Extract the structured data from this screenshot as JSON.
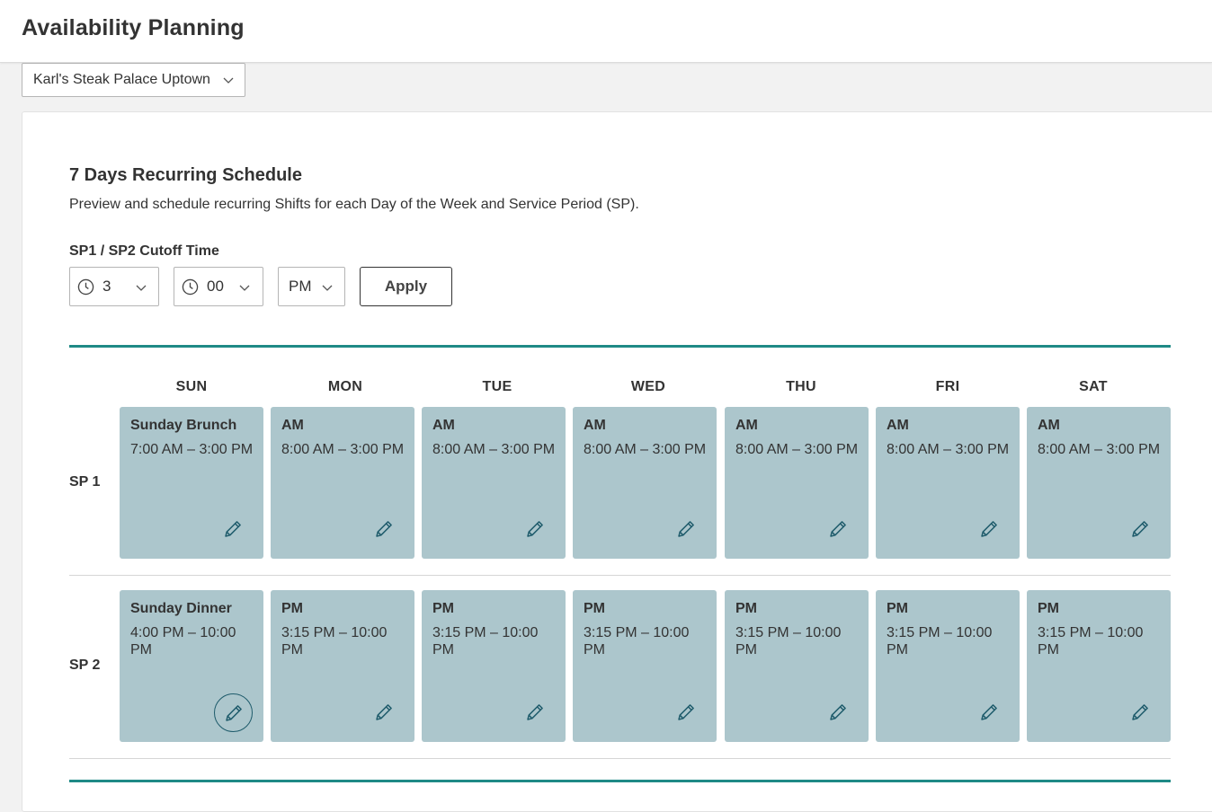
{
  "header": {
    "title": "Availability Planning"
  },
  "location": {
    "selected": "Karl's Steak Palace Uptown"
  },
  "schedule": {
    "title": "7 Days Recurring Schedule",
    "description": "Preview and schedule recurring Shifts for each Day of the Week and Service Period (SP).",
    "cutoff": {
      "label": "SP1 / SP2 Cutoff Time",
      "hour": "3",
      "minute": "00",
      "ampm": "PM",
      "apply_label": "Apply"
    },
    "days": [
      "SUN",
      "MON",
      "TUE",
      "WED",
      "THU",
      "FRI",
      "SAT"
    ],
    "rows": [
      {
        "label": "SP 1",
        "shifts": [
          {
            "name": "Sunday Brunch",
            "time": "7:00 AM – 3:00 PM"
          },
          {
            "name": "AM",
            "time": "8:00 AM – 3:00 PM"
          },
          {
            "name": "AM",
            "time": "8:00 AM – 3:00 PM"
          },
          {
            "name": "AM",
            "time": "8:00 AM – 3:00 PM"
          },
          {
            "name": "AM",
            "time": "8:00 AM – 3:00 PM"
          },
          {
            "name": "AM",
            "time": "8:00 AM – 3:00 PM"
          },
          {
            "name": "AM",
            "time": "8:00 AM – 3:00 PM"
          }
        ]
      },
      {
        "label": "SP 2",
        "shifts": [
          {
            "name": "Sunday Dinner",
            "time": "4:00 PM – 10:00 PM"
          },
          {
            "name": "PM",
            "time": "3:15 PM – 10:00 PM"
          },
          {
            "name": "PM",
            "time": "3:15 PM – 10:00 PM"
          },
          {
            "name": "PM",
            "time": "3:15 PM – 10:00 PM"
          },
          {
            "name": "PM",
            "time": "3:15 PM – 10:00 PM"
          },
          {
            "name": "PM",
            "time": "3:15 PM – 10:00 PM"
          },
          {
            "name": "PM",
            "time": "3:15 PM – 10:00 PM"
          }
        ]
      }
    ]
  },
  "icons": {
    "edit": "pencil-icon",
    "clock": "clock-icon",
    "dropdown": "chevron-down-icon"
  },
  "colors": {
    "accent": "#1f8a86",
    "shift_bg": "#acc6cc",
    "icon": "#1e5b6b"
  }
}
